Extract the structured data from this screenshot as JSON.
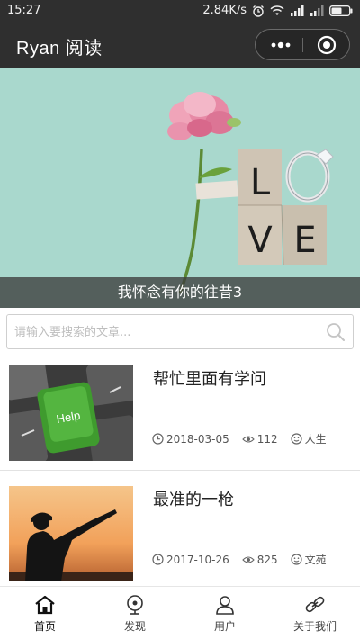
{
  "status_bar": {
    "time": "15:27",
    "net_speed": "2.84K/s"
  },
  "nav": {
    "title": "Ryan 阅读"
  },
  "banner": {
    "caption": "我怀念有你的往昔3",
    "image_letters": [
      "L",
      "O",
      "V",
      "E"
    ]
  },
  "search": {
    "placeholder": "请输入要搜索的文章..."
  },
  "articles": [
    {
      "title": "帮忙里面有学问",
      "date": "2018-03-05",
      "views": "112",
      "category": "人生",
      "thumb_text": "Help"
    },
    {
      "title": "最准的一枪",
      "date": "2017-10-26",
      "views": "825",
      "category": "文苑"
    }
  ],
  "tabs": [
    {
      "label": "首页",
      "icon": "home-icon",
      "active": true
    },
    {
      "label": "发现",
      "icon": "discover-icon",
      "active": false
    },
    {
      "label": "用户",
      "icon": "user-icon",
      "active": false
    },
    {
      "label": "关于我们",
      "icon": "link-icon",
      "active": false
    }
  ],
  "colors": {
    "bar_background": "#2f2f2f",
    "banner_background": "#a9d8cd",
    "key_green": "#3f9b2e"
  }
}
